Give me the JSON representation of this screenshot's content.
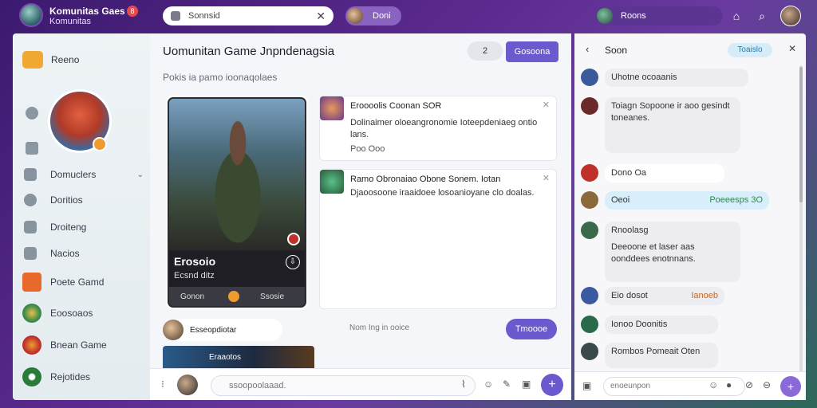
{
  "topbar": {
    "title": "Komunitas Gaes",
    "subtitle": "Komunitas",
    "badge": "8",
    "search_value": "Sonnsid",
    "user_chip": "Doni",
    "right_chip": "Roons"
  },
  "sidebar": {
    "top_label": "Reeno",
    "nav": [
      {
        "label": "Domuclers"
      },
      {
        "label": "Doritios"
      },
      {
        "label": "Droiteng"
      },
      {
        "label": "Nacios"
      }
    ],
    "games": [
      {
        "label": "Poete Gamd",
        "color": "#e86a2a"
      },
      {
        "label": "Eoosoaos",
        "color": "#3a8a4a"
      },
      {
        "label": "Bnean Game",
        "color": "#c0302a"
      },
      {
        "label": "Rejotides",
        "color": "#2a7a3a"
      }
    ]
  },
  "main": {
    "title": "Uomunitan Game Jnpndenagsia",
    "pill": "2",
    "primary_button": "Gosoona",
    "subtitle": "Pokis ia pamo ioonaqolaes",
    "hero": {
      "name": "Erosoio",
      "tag": "Ecsnd ditz",
      "foot_left": "Gonon",
      "foot_right": "Ssosie"
    },
    "posts": [
      {
        "title": "Eroooolis Coonan SOR",
        "body": "Dolinaimer oloeangronomie Ioteepdeniaeg ontio lans.",
        "reactions": "Poo Ooo"
      },
      {
        "title": "Ramo Obronaiao Obone Sonem. Iotan",
        "body": "Djaoosoone iraaidoee losoanioyane clo doalas."
      }
    ],
    "mini_user": "Esseopdiotar",
    "mini_hint": "Nom Ing in ooice",
    "follow_button": "Tmoooe",
    "banner_text": "Eraaotos",
    "compose_placeholder": "ssoopoolaaad."
  },
  "chat": {
    "name": "Soon",
    "tag": "Toaislo",
    "messages": [
      {
        "text": "Uhotne ocoaanis",
        "color": "#3a5a9a"
      },
      {
        "text": "Toiagn Sopoone ir aoo gesindt toneanes.",
        "color": "#6a2a2a"
      },
      {
        "text": "Dono Oa",
        "color": "#c0302a"
      },
      {
        "text": "Oeoi",
        "sub": "Poeeesps 3O",
        "color": "#8a6a3a"
      },
      {
        "text": "Rnoolasg",
        "color": "#3a6a4a"
      },
      {
        "text": "Deeoone et laser aas oonddees enotnnans.",
        "color": "#3a6a4a"
      },
      {
        "text": "Eio dosot",
        "sub": "Ianoeb",
        "color": "#3a5aa0"
      },
      {
        "text": "Ionoo Doonitis",
        "color": "#2a6a4a"
      },
      {
        "text": "Rombos Pomeait Oten",
        "color": "#3a4a4a"
      }
    ],
    "compose_placeholder": "enoeunpon"
  }
}
